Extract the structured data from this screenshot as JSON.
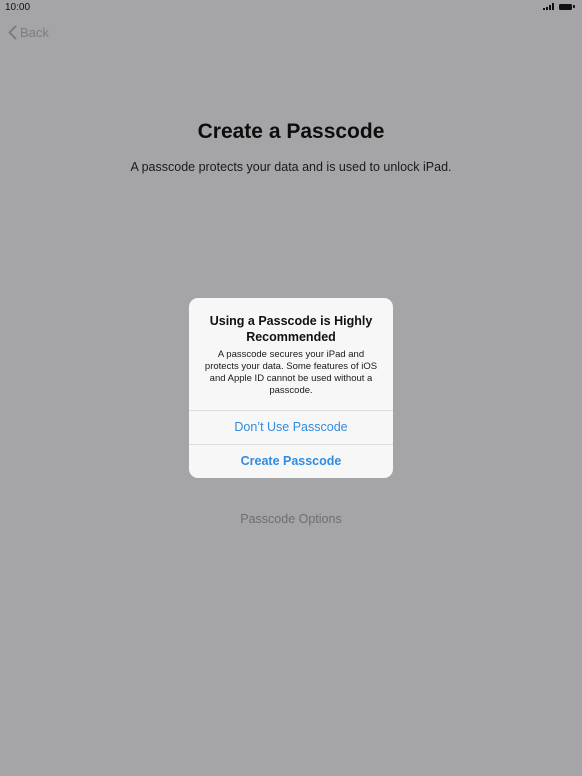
{
  "status_bar": {
    "time": "10:00",
    "icons": [
      "signal-icon",
      "battery-icon"
    ]
  },
  "nav": {
    "back_label": "Back",
    "back_icon": "chevron-left-icon"
  },
  "main": {
    "title": "Create a Passcode",
    "subtitle": "A passcode protects your data and is used to unlock iPad.",
    "options_label": "Passcode Options"
  },
  "alert": {
    "title": "Using a Passcode is Highly Recommended",
    "message": "A passcode secures your iPad and protects your data. Some features of iOS and Apple ID cannot be used without a passcode.",
    "dont_use_label": "Don’t Use Passcode",
    "create_label": "Create Passcode"
  },
  "colors": {
    "dimmed_background": "#a5a4a7",
    "accent": "#2f8ce0",
    "alert_background": "#f7f7f8"
  }
}
